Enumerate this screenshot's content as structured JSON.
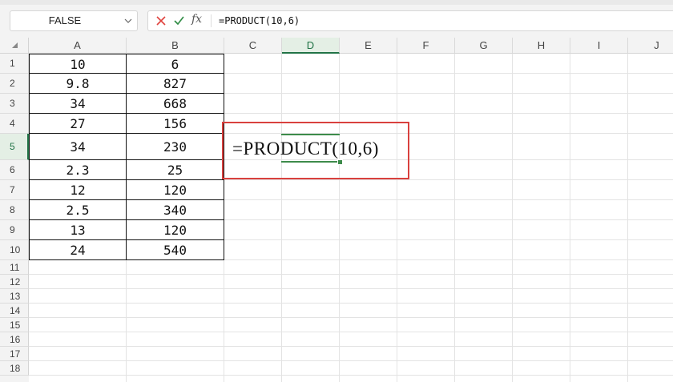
{
  "name_box": {
    "value": "FALSE"
  },
  "formula_bar": {
    "cancel_icon": "cross-icon",
    "enter_icon": "check-icon",
    "function_label": "fx",
    "content": "=PRODUCT(10,6)"
  },
  "columns": [
    "A",
    "B",
    "C",
    "D",
    "E",
    "F",
    "G",
    "H",
    "I",
    "J"
  ],
  "active_column": "D",
  "rows": [
    "1",
    "2",
    "3",
    "4",
    "5",
    "6",
    "7",
    "8",
    "9",
    "10",
    "11",
    "12",
    "13",
    "14",
    "15",
    "16",
    "17",
    "18"
  ],
  "active_row": "5",
  "table": [
    {
      "a": "10",
      "b": "6"
    },
    {
      "a": "9.8",
      "b": "827"
    },
    {
      "a": "34",
      "b": "668"
    },
    {
      "a": "27",
      "b": "156"
    },
    {
      "a": "34",
      "b": "230"
    },
    {
      "a": "2.3",
      "b": "25"
    },
    {
      "a": "12",
      "b": "120"
    },
    {
      "a": "2.5",
      "b": "340"
    },
    {
      "a": "13",
      "b": "120"
    },
    {
      "a": "24",
      "b": "540"
    }
  ],
  "cell_c5": "=PRODUCT(10,6)",
  "colors": {
    "accent_green": "#217346",
    "highlight_red": "#d9413e"
  }
}
